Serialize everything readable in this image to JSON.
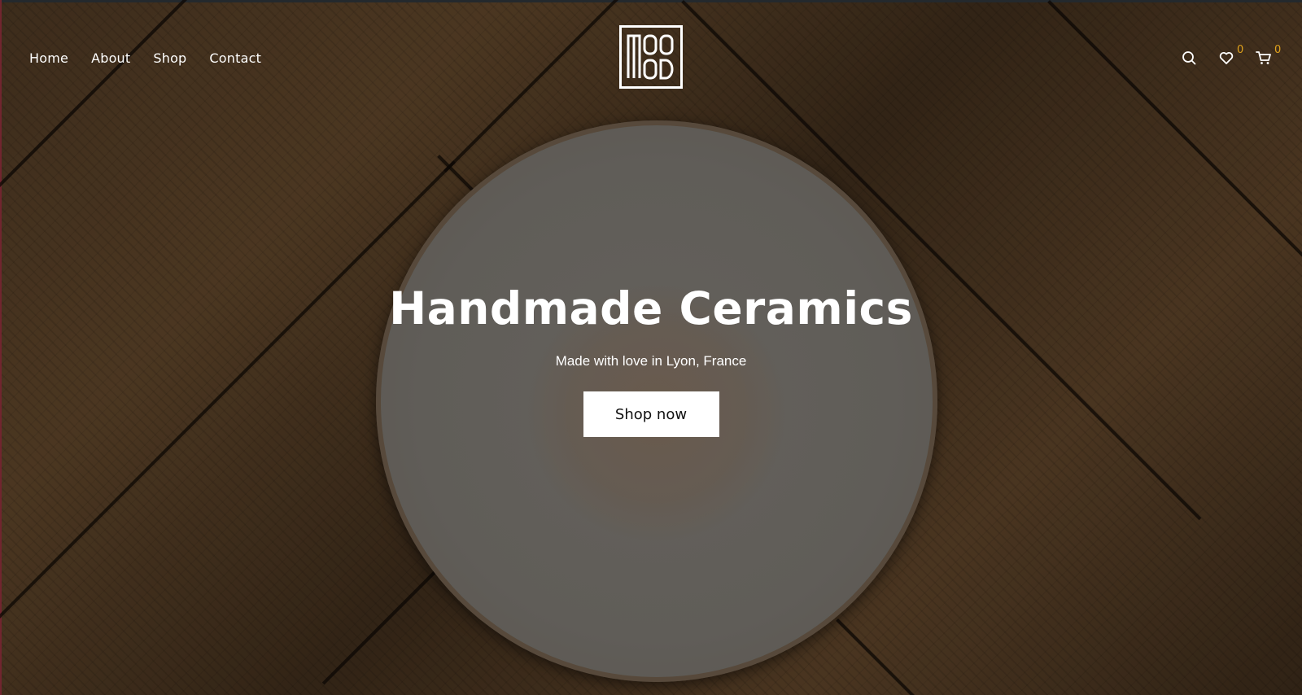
{
  "nav": {
    "items": [
      {
        "label": "Home"
      },
      {
        "label": "About"
      },
      {
        "label": "Shop"
      },
      {
        "label": "Contact"
      }
    ]
  },
  "header": {
    "logo_text": "MOOD",
    "wishlist_count": "0",
    "cart_count": "0",
    "accent_color": "#e0a21c"
  },
  "hero": {
    "title": "Handmade Ceramics",
    "subtitle": "Made with love in Lyon, France",
    "cta_label": "Shop now"
  },
  "icons": [
    "search-icon",
    "heart-icon",
    "cart-icon"
  ]
}
